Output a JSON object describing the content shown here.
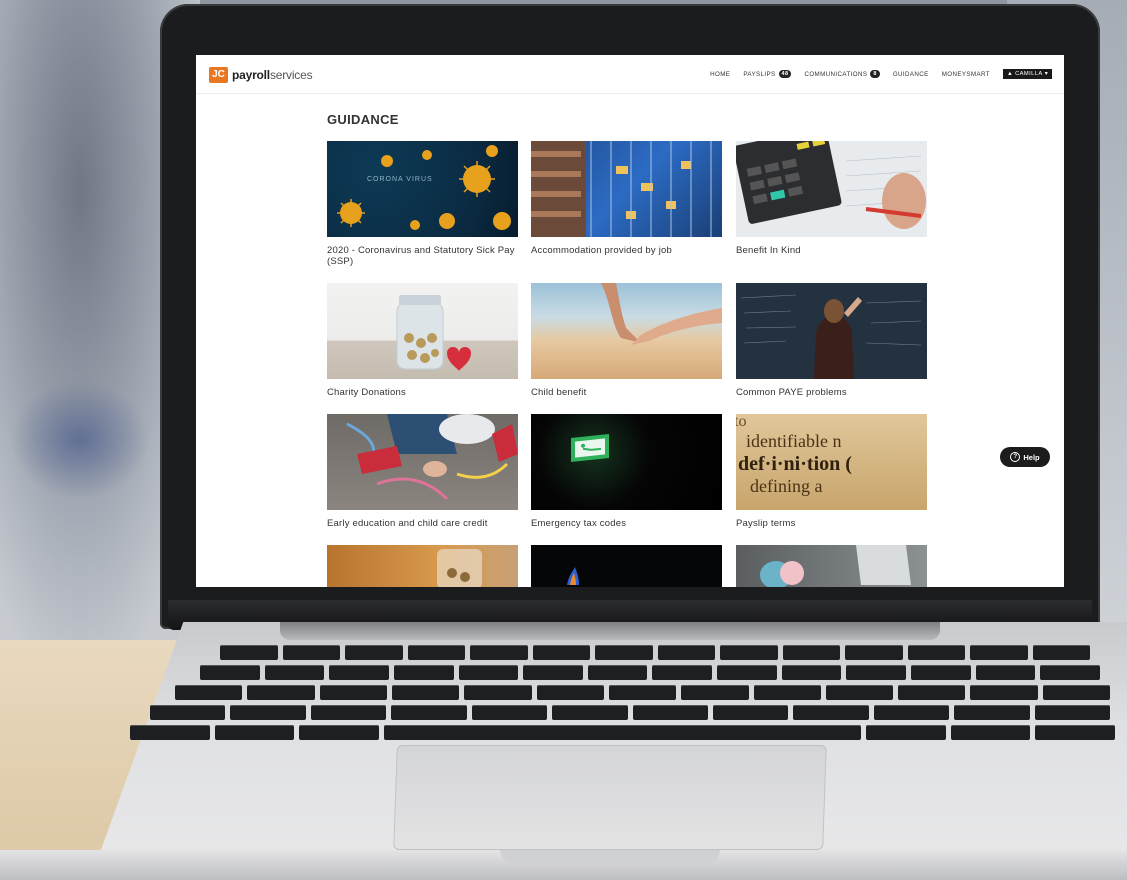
{
  "header": {
    "logo_mark": "JC",
    "logo_text_bold": "payroll",
    "logo_text_light": "services",
    "nav": {
      "home": "HOME",
      "payslips": "PAYSLIPS",
      "payslips_count": "48",
      "communications": "COMMUNICATIONS",
      "communications_count": "8",
      "guidance": "GUIDANCE",
      "moneysmart": "MONEYSMART",
      "user": "CAMILLA"
    }
  },
  "page_title": "GUIDANCE",
  "cards": [
    {
      "label": "2020 - Coronavirus and Statutory Sick Pay (SSP)",
      "image_text": "CORONA VIRUS"
    },
    {
      "label": "Accommodation provided by job"
    },
    {
      "label": "Benefit In Kind"
    },
    {
      "label": "Charity Donations"
    },
    {
      "label": "Child benefit"
    },
    {
      "label": "Common PAYE problems"
    },
    {
      "label": "Early education and child care credit"
    },
    {
      "label": "Emergency tax codes"
    },
    {
      "label": "Payslip terms",
      "image_text": [
        "identifiable n",
        "def·i·ni·tion (",
        "defining  a"
      ]
    }
  ],
  "help_button": "Help",
  "colors": {
    "accent": "#e87722",
    "dark": "#1c1c1c"
  }
}
